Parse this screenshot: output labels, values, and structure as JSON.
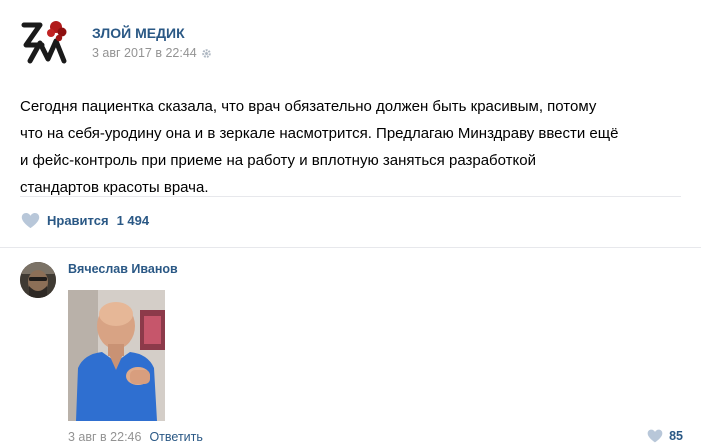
{
  "post": {
    "author": "ЗЛОЙ МЕДИК",
    "date": "3 авг 2017 в 22:44",
    "text_lines": [
      "Сегодня пациентка сказала, что врач обязательно должен быть красивым, потому",
      "что на себя-уродину она и в зеркале насмотрится. Предлагаю Минздраву ввести ещё",
      "и фейс-контроль при приеме на работу и вплотную заняться разработкой",
      "стандартов красоты врача."
    ],
    "likes_label": "Нравится",
    "likes_count": "1 494"
  },
  "comment": {
    "author": "Вячеслав Иванов",
    "date": "3 авг в 22:46",
    "reply_label": "Ответить",
    "likes_count": "85"
  },
  "colors": {
    "link": "#2a5885",
    "meta": "#939393",
    "divider": "#e7e8ec",
    "heart": "#b8c7d9"
  }
}
